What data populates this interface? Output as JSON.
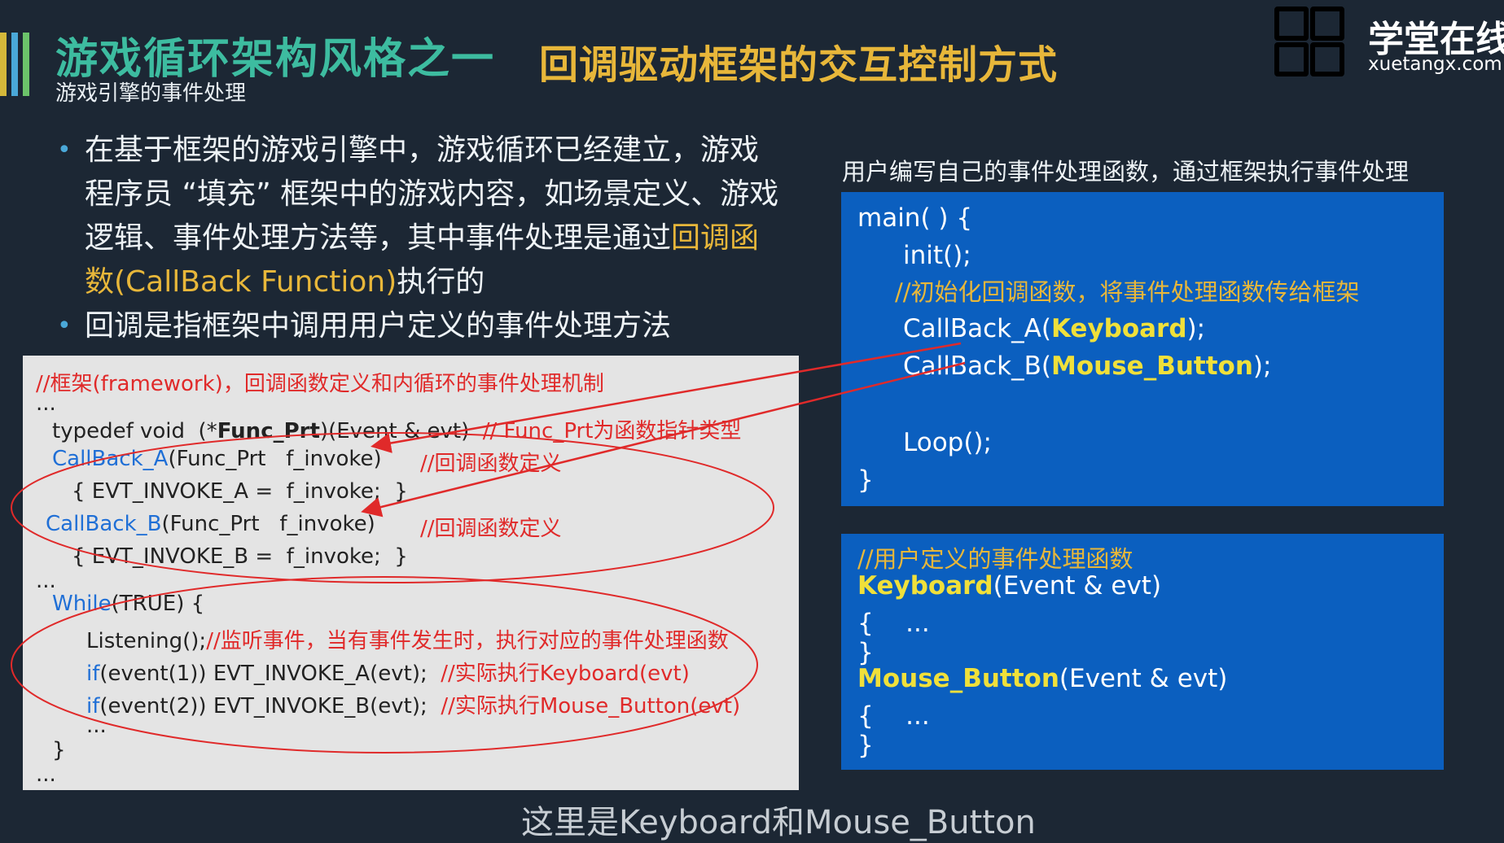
{
  "header": {
    "title": "游戏循环架构风格之一",
    "subtitle": "游戏引擎的事件处理",
    "title_right": "回调驱动框架的交互控制方式"
  },
  "logo": {
    "cn": "学堂在线",
    "en": "xuetangx.com"
  },
  "bullets": {
    "b1_pre": "在基于框架的游戏引擎中，游戏循环已经建立，游戏程序员 “填充” 框架中的游戏内容，如场景定义、游戏逻辑、事件处理方法等，其中事件处理是通过",
    "b1_hl": "回调函数(CallBack Function)",
    "b1_post": "执行的",
    "b2": "回调是指框架中调用用户定义的事件处理方法"
  },
  "framework_code": {
    "comment_title": "//框架(framework)，回调函数定义和内循环的事件处理机制",
    "ellipsis": "...",
    "typedef_a": "typedef void  (*",
    "typedef_b": "Func_Prt",
    "typedef_c": ")(Event & evt)",
    "typedef_comment": "// Func_Prt为函数指针类型",
    "cba_name": "CallBack_A",
    "cba_args": "(Func_Prt   f_invoke)",
    "cb_comment": "//回调函数定义",
    "cba_body": "{ EVT_INVOKE_A =  f_invoke;  }",
    "cbb_name": "CallBack_B",
    "cbb_args": "(Func_Prt   f_invoke)",
    "cbb_body": "{ EVT_INVOKE_B =  f_invoke;  }",
    "while_kw": "While",
    "while_rest": "(TRUE) {",
    "listening": "Listening();",
    "listening_comment": "//监听事件，当有事件发生时，执行对应的事件处理函数",
    "if_kw": "if",
    "if1": "(event(1)) EVT_INVOKE_A(evt);",
    "if1_comment": "//实际执行Keyboard(evt)",
    "if2": "(event(2)) EVT_INVOKE_B(evt);",
    "if2_comment": "//实际执行Mouse_Button(evt)",
    "close_brace": "}"
  },
  "right_caption": "用户编写自己的事件处理函数，通过框架执行事件处理",
  "main_code": {
    "main": "main( ) {",
    "init": "init();",
    "init_comment": "//初始化回调函数，将事件处理函数传给框架",
    "cba_pre": "CallBack_A(",
    "cba_arg": "Keyboard",
    "cb_post": ");",
    "cbb_pre": "CallBack_B(",
    "cbb_arg": "Mouse_Button",
    "loop": "Loop();",
    "close": "}"
  },
  "user_code": {
    "comment": "//用户定义的事件处理函数",
    "kb_name": "Keyboard",
    "params": "(Event & evt)",
    "open": "{    ...",
    "close": "}",
    "mb_name": "Mouse_Button"
  },
  "bottom_caption": "这里是Keyboard和Mouse_Button"
}
